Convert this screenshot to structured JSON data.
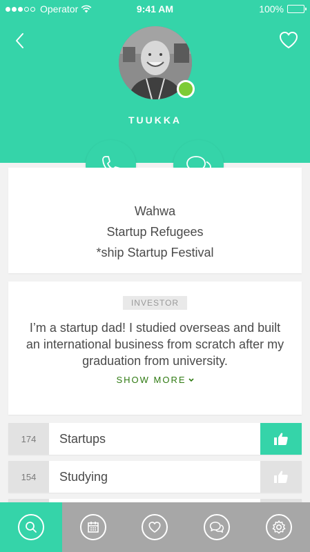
{
  "status_bar": {
    "carrier": "Operator",
    "time": "9:41 AM",
    "battery": "100%"
  },
  "profile": {
    "name": "TUUKKA",
    "online": true,
    "info_lines": [
      "Wahwa",
      "Startup Refugees",
      "*ship Startup Festival"
    ],
    "role": "INVESTOR",
    "bio": "I’m a startup dad! I studied overseas and built an international business from scratch after my graduation from university.",
    "show_more": "SHOW MORE"
  },
  "tags": [
    {
      "count": "174",
      "label": "Startups",
      "liked": true
    },
    {
      "count": "154",
      "label": "Studying",
      "liked": false
    }
  ],
  "tabbar": {
    "items": [
      "search-icon",
      "calendar-icon",
      "heart-icon",
      "chat-icon",
      "settings-icon"
    ],
    "active_index": 0
  },
  "colors": {
    "accent": "#35d4a9",
    "online": "#7dcb35",
    "show_more": "#2f7a12",
    "tabbar": "#a7a7a7"
  }
}
